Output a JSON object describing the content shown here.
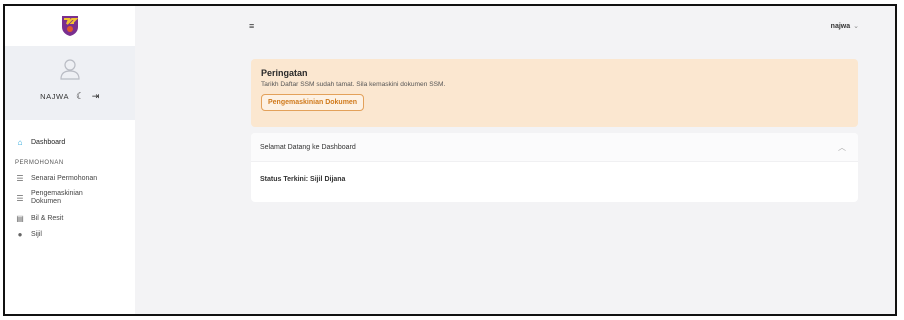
{
  "sidebar": {
    "user_name": "NAJWA",
    "nav": {
      "dashboard": "Dashboard",
      "section": "PERMOHONAN",
      "senarai": "Senarai Permohonan",
      "pengemaskinian": "Pengemaskinian Dokumen",
      "bil": "Bil & Resit",
      "sijil": "Sijil"
    }
  },
  "topbar": {
    "user": "najwa"
  },
  "alert": {
    "title": "Peringatan",
    "text": "Tarikh Daftar SSM sudah tamat. Sila kemaskini dokumen SSM.",
    "button": "Pengemaskinian Dokumen"
  },
  "card": {
    "title": "Selamat Datang ke Dashboard",
    "status": "Status Terkini: Sijil Dijana"
  },
  "colors": {
    "alert_bg": "#fbe7d0",
    "alert_button": "#d07a1c",
    "active_icon": "#1aa0d8",
    "sidebar_user_bg": "#eef0f4"
  }
}
